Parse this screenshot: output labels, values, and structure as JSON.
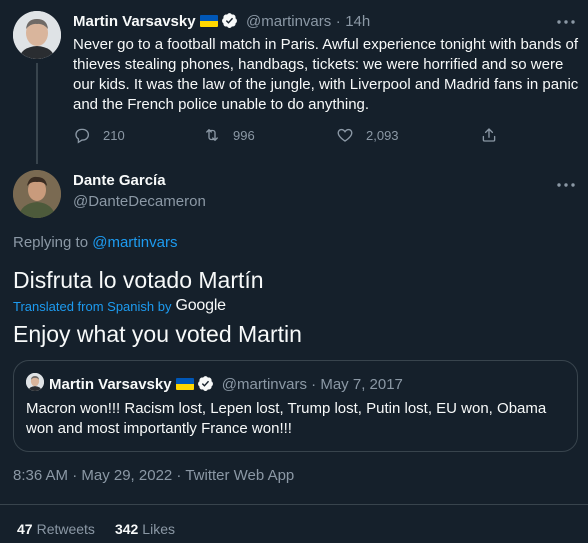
{
  "parent_tweet": {
    "author_name": "Martin Varsavsky",
    "handle": "@martinvars",
    "separator": "·",
    "time_ago": "14h",
    "text": "Never go to a football match in Paris. Awful experience tonight with bands of thieves stealing phones, handbags, tickets: we were horrified and so were our kids. It was the law of the jungle, with Liverpool and Madrid fans in panic and the French police unable to do anything.",
    "reply_count": "210",
    "retweet_count": "996",
    "like_count": "2,093"
  },
  "reply_tweet": {
    "author_name": "Dante García",
    "handle": "@DanteDecameron",
    "replying_prefix": "Replying to",
    "replying_handle": "@martinvars",
    "text": "Disfruta lo votado Martín",
    "translated_label": "Translated from Spanish by",
    "translator": "Google",
    "translation": "Enjoy what you voted Martin",
    "timestamp": "8:36 AM · May 29, 2022 · Twitter Web App",
    "retweets_count": "47",
    "retweets_label": "Retweets",
    "likes_count": "342",
    "likes_label": "Likes"
  },
  "quoted_tweet": {
    "author_name": "Martin Varsavsky",
    "handle": "@martinvars",
    "separator": "·",
    "date": "May 7, 2017",
    "text": "Macron won!!! Racism lost, Lepen lost, Trump lost, Putin lost,  EU won, Obama won and most importantly France won!!!"
  },
  "colors": {
    "background": "#15202b",
    "text": "#f7f9f9",
    "muted": "#8b98a5",
    "accent": "#1d9bf0",
    "border": "#38444d"
  },
  "icons": [
    "more-icon",
    "reply-icon",
    "retweet-icon",
    "like-icon",
    "share-icon",
    "verified-badge-icon",
    "ukraine-flag-icon"
  ]
}
